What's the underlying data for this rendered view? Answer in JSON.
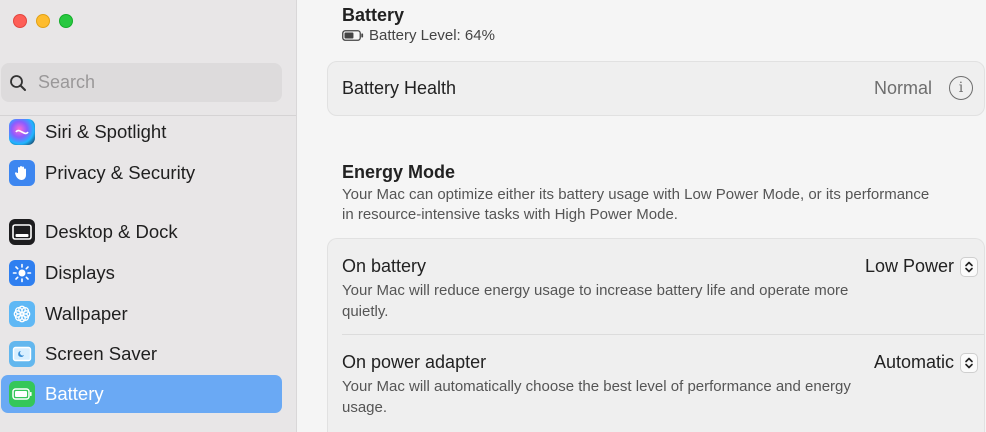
{
  "window": {
    "traffic_lights": [
      "close",
      "minimize",
      "zoom"
    ]
  },
  "sidebar": {
    "search": {
      "placeholder": "Search",
      "value": ""
    },
    "items": [
      {
        "label": "Siri & Spotlight",
        "icon": "siri-icon"
      },
      {
        "label": "Privacy & Security",
        "icon": "hand-icon"
      },
      {
        "label": "Desktop & Dock",
        "icon": "dock-icon"
      },
      {
        "label": "Displays",
        "icon": "sun-icon"
      },
      {
        "label": "Wallpaper",
        "icon": "flower-icon"
      },
      {
        "label": "Screen Saver",
        "icon": "screensaver-icon"
      },
      {
        "label": "Battery",
        "icon": "battery-icon",
        "selected": true
      }
    ]
  },
  "main": {
    "title": "Battery",
    "battery_level": "Battery Level: 64%",
    "battery_level_fraction": 0.64,
    "health": {
      "label": "Battery Health",
      "value": "Normal"
    },
    "energy_mode": {
      "title": "Energy Mode",
      "description": "Your Mac can optimize either its battery usage with Low Power Mode, or its performance in resource-intensive tasks with High Power Mode.",
      "rows": [
        {
          "title": "On battery",
          "description": "Your Mac will reduce energy usage to increase battery life and operate more quietly.",
          "value": "Low Power"
        },
        {
          "title": "On power adapter",
          "description": "Your Mac will automatically choose the best level of performance and energy usage.",
          "value": "Automatic"
        }
      ]
    }
  },
  "colors": {
    "selected_bg": "#6aa9f4",
    "close": "#fe5f57",
    "minimize": "#febc2e",
    "zoom": "#28c840"
  }
}
